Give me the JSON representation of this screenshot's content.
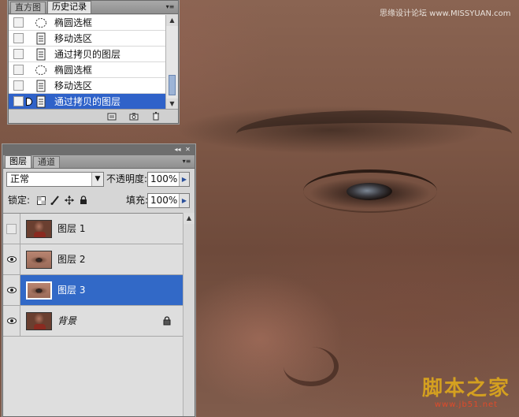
{
  "watermark_top": "思缘设计论坛 www.MISSYUAN.com",
  "watermark_bottom": {
    "big": "脚本之家",
    "small": "www.jb51.net"
  },
  "history_panel": {
    "tabs": [
      "直方图",
      "历史记录"
    ],
    "active_tab": "历史记录",
    "menu_icon": "panel-menu-icon",
    "items": [
      {
        "label": "椭圆选框",
        "icon": "ellipse-marquee-icon"
      },
      {
        "label": "移动选区",
        "icon": "history-state-icon"
      },
      {
        "label": "通过拷贝的图层",
        "icon": "history-state-icon"
      },
      {
        "label": "椭圆选框",
        "icon": "ellipse-marquee-icon"
      },
      {
        "label": "移动选区",
        "icon": "history-state-icon"
      },
      {
        "label": "通过拷贝的图层",
        "icon": "history-state-icon",
        "selected": true
      }
    ],
    "footer_icons": [
      "new-document-from-state-icon",
      "camera-snapshot-icon",
      "trash-icon"
    ]
  },
  "layers_panel": {
    "tabs": [
      "图层",
      "通道"
    ],
    "active_tab": "图层",
    "blend_mode": "正常",
    "opacity_label": "不透明度:",
    "opacity_value": "100%",
    "lock_label": "锁定:",
    "fill_label": "填充:",
    "fill_value": "100%",
    "lock_icons": [
      "lock-transparent-icon",
      "lock-image-icon",
      "lock-position-icon",
      "lock-all-icon"
    ],
    "layers": [
      {
        "name": "图层 1",
        "visible": false,
        "thumb": "portrait",
        "selected": false
      },
      {
        "name": "图层 2",
        "visible": true,
        "thumb": "eye",
        "selected": false
      },
      {
        "name": "图层 3",
        "visible": true,
        "thumb": "eye",
        "selected": true
      },
      {
        "name": "背景",
        "visible": true,
        "thumb": "portrait",
        "selected": false,
        "locked": true,
        "italic": true
      }
    ]
  },
  "colors": {
    "selection": "#3269c7",
    "panel": "#d6d6d6"
  }
}
